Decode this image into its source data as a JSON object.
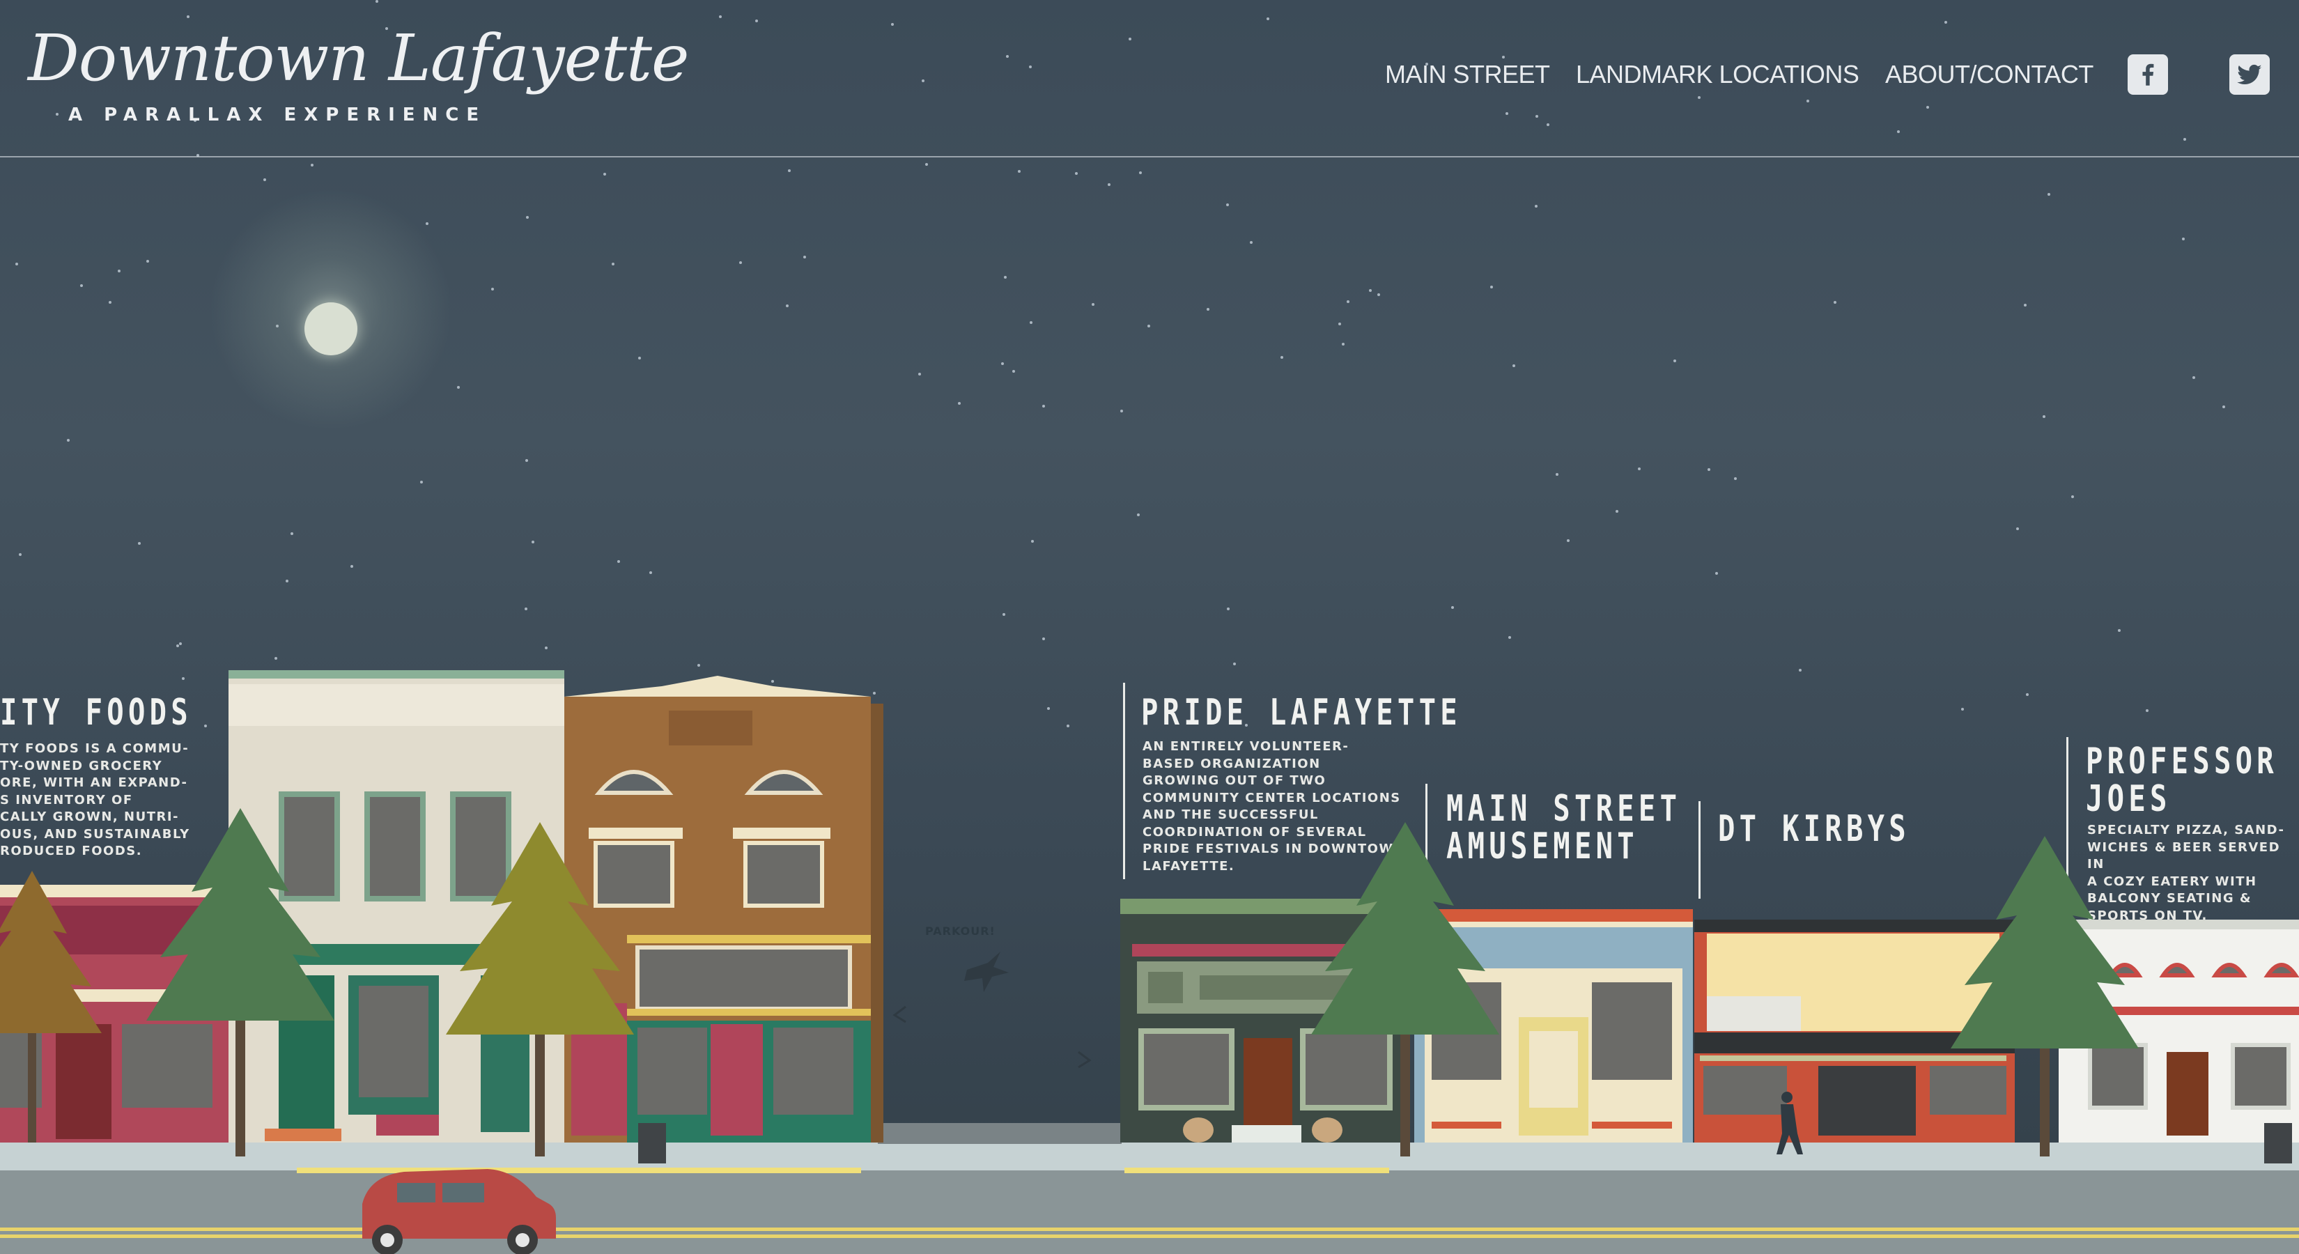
{
  "header": {
    "logo_script": "Downtown Lafayette",
    "logo_subtitle": "A PARALLAX EXPERIENCE",
    "nav": [
      "MAIN STREET",
      "LANDMARK LOCATIONS",
      "ABOUT/CONTACT"
    ],
    "social_icons": [
      "facebook-icon",
      "twitter-icon"
    ]
  },
  "scene": {
    "parkour_label": "PARKOUR!",
    "locations": [
      {
        "title": "ITY FOODS",
        "desc": "TY FOODS IS A COMMU-\nTY-OWNED GROCERY\nORE, WITH AN EXPAND-\nS INVENTORY OF\nCALLY GROWN, NUTRI-\nOUS, AND SUSTAINABLY\nRODUCED FOODS."
      },
      {
        "title": "PRIDE LAFAYETTE",
        "desc": "AN ENTIRELY VOLUNTEER-\nBASED ORGANIZATION\nGROWING OUT OF TWO\nCOMMUNITY CENTER LOCATIONS\nAND THE SUCCESSFUL\nCOORDINATION OF SEVERAL\nPRIDE FESTIVALS IN DOWNTOWN\nLAFAYETTE."
      },
      {
        "title": "MAIN STREET\nAMUSEMENT",
        "desc": ""
      },
      {
        "title": "DT KIRBYS",
        "desc": ""
      },
      {
        "title": "PROFESSOR\nJOES",
        "desc": "SPECIALTY PIZZA, SAND-\nWICHES & BEER SERVED IN\nA COZY EATERY WITH\nBALCONY SEATING &\nSPORTS ON TV."
      }
    ]
  },
  "colors": {
    "sky_top": "#3c4b58",
    "sky_bottom": "#334049",
    "text": "#eef0f2",
    "tree_green": "#4f7a50",
    "tree_olive": "#8e8a2e",
    "car_red": "#b94a45"
  }
}
